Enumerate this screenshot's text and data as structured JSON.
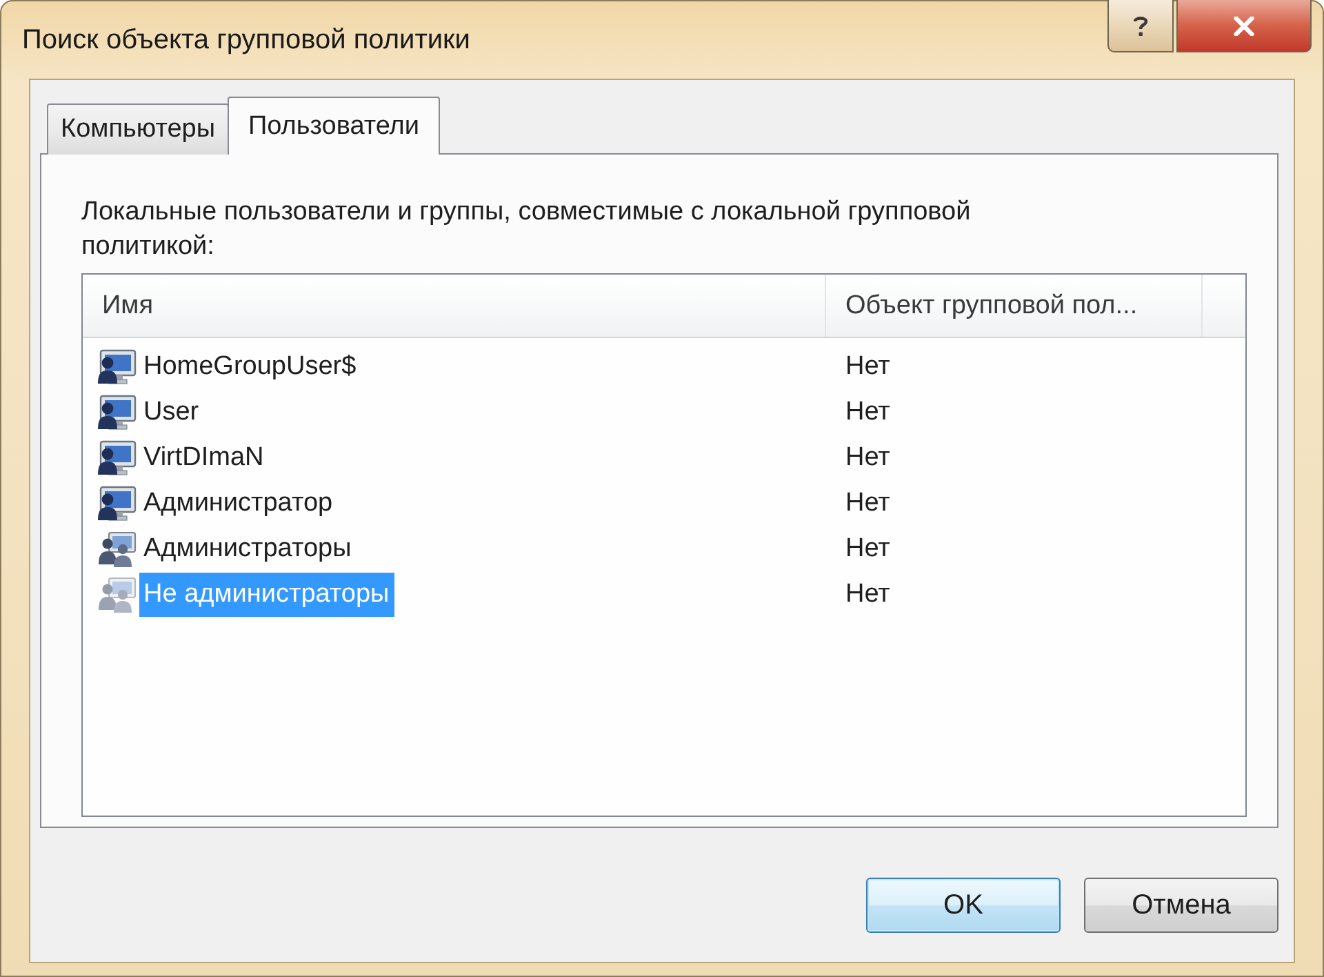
{
  "window": {
    "title": "Поиск объекта групповой политики"
  },
  "tabs": [
    {
      "label": "Компьютеры",
      "selected": false
    },
    {
      "label": "Пользователи",
      "selected": true
    }
  ],
  "panel": {
    "description": "Локальные пользователи и группы, совместимые с локальной групповой политикой:",
    "list": {
      "columns": [
        "Имя",
        "Объект групповой пол..."
      ],
      "rows": [
        {
          "name": "HomeGroupUser$",
          "kind": "user",
          "gpo": "Нет",
          "selected": false
        },
        {
          "name": "User",
          "kind": "user",
          "gpo": "Нет",
          "selected": false
        },
        {
          "name": "VirtDImaN",
          "kind": "user",
          "gpo": "Нет",
          "selected": false
        },
        {
          "name": "Администратор",
          "kind": "user",
          "gpo": "Нет",
          "selected": false
        },
        {
          "name": "Администраторы",
          "kind": "group",
          "gpo": "Нет",
          "selected": false
        },
        {
          "name": "Не администраторы",
          "kind": "group",
          "gpo": "Нет",
          "selected": true
        }
      ]
    }
  },
  "buttons": [
    {
      "label": "OK",
      "default": true
    },
    {
      "label": "Отмена",
      "default": false
    }
  ]
}
